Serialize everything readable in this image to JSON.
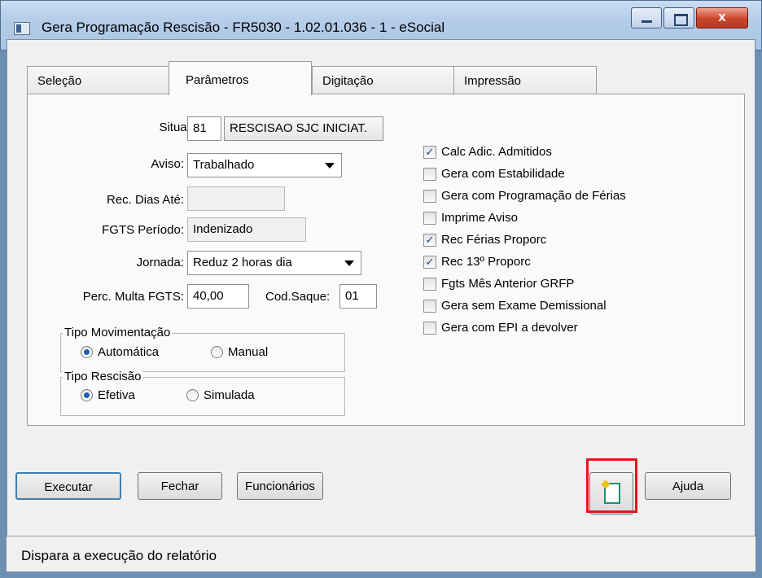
{
  "window": {
    "title": "Gera Programação Rescisão - FR5030 - 1.02.01.036 - 1 - eSocial",
    "close_glyph": "x"
  },
  "tabs": [
    {
      "label": "Seleção"
    },
    {
      "label": "Parâmetros",
      "active": true
    },
    {
      "label": "Digitação"
    },
    {
      "label": "Impressão"
    }
  ],
  "form": {
    "situacao_label": "Situação:",
    "situacao_value": "81",
    "situacao_desc": "RESCISAO SJC INICIAT.",
    "aviso_label": "Aviso:",
    "aviso_value": "Trabalhado",
    "rec_dias_label": "Rec. Dias Até:",
    "rec_dias_value": "",
    "fgts_periodo_label": "FGTS Período:",
    "fgts_periodo_value": "Indenizado",
    "jornada_label": "Jornada:",
    "jornada_value": "Reduz 2 horas dia",
    "perc_multa_label": "Perc. Multa FGTS:",
    "perc_multa_value": "40,00",
    "cod_saque_label": "Cod.Saque:",
    "cod_saque_value": "01"
  },
  "tipo_movimentacao": {
    "title": "Tipo Movimentação",
    "options": [
      "Automática",
      "Manual"
    ],
    "selected": "Automática"
  },
  "tipo_rescisao": {
    "title": "Tipo Rescisão",
    "options": [
      "Efetiva",
      "Simulada"
    ],
    "selected": "Efetiva"
  },
  "checks": [
    {
      "label": "Calc Adic. Admitidos",
      "checked": true
    },
    {
      "label": "Gera com Estabilidade",
      "checked": false
    },
    {
      "label": "Gera com Programação de Férias",
      "checked": false
    },
    {
      "label": "Imprime Aviso",
      "checked": false
    },
    {
      "label": "Rec Férias Proporc",
      "checked": true
    },
    {
      "label": "Rec 13º Proporc",
      "checked": true
    },
    {
      "label": "Fgts Mês Anterior GRFP",
      "checked": false
    },
    {
      "label": "Gera sem Exame Demissional",
      "checked": false
    },
    {
      "label": "Gera com EPI a devolver",
      "checked": false
    }
  ],
  "buttons": {
    "executar": "Executar",
    "fechar": "Fechar",
    "funcionarios": "Funcionários",
    "ajuda": "Ajuda"
  },
  "status": "Dispara a execução do relatório",
  "colors": {
    "highlight": "#e0181c",
    "title_gradient": "#b5cde9"
  }
}
